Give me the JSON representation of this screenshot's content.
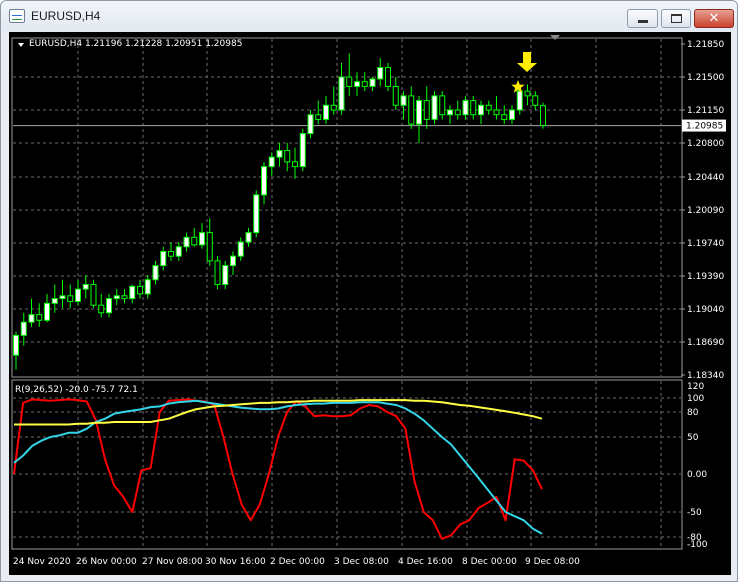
{
  "window": {
    "title": "EURUSD,H4",
    "buttons": {
      "minimize": "minimize",
      "maximize": "maximize",
      "close": "✕"
    }
  },
  "colors": {
    "background": "#000000",
    "grid": "#6b6b6b",
    "bull_candle": "#ffffff",
    "bear_candle": "#000000",
    "candle_outline": "#00ff00",
    "text": "#ffffff",
    "indicator_red": "#ff0000",
    "indicator_cyan": "#33d6e8",
    "indicator_yellow": "#ffff44",
    "marker": "#ffee00"
  },
  "price_panel": {
    "header_label": "EURUSD,H4  1.21196 1.21228 1.20951 1.20985",
    "current_price": "1.20985",
    "y_ticks": [
      "1.21850",
      "1.21500",
      "1.21150",
      "1.20800",
      "1.20440",
      "1.20090",
      "1.19740",
      "1.19390",
      "1.19040",
      "1.18690",
      "1.18340"
    ],
    "annotations": [
      "yellow-star",
      "yellow-down-arrow"
    ]
  },
  "indicator_panel": {
    "header_label": "R(9,26,52) -20.0 -75.7 72.1",
    "y_ticks": [
      "120",
      "100",
      "80",
      "50",
      "0.00",
      "-50",
      "-80",
      "-100"
    ]
  },
  "x_ticks": [
    "24 Nov 2020",
    "26 Nov 00:00",
    "27 Nov 08:00",
    "30 Nov 16:00",
    "2 Dec 00:00",
    "3 Dec 08:00",
    "4 Dec 16:00",
    "8 Dec 00:00",
    "9 Dec 08:00"
  ],
  "chart_data": [
    {
      "type": "candlestick",
      "title": "EURUSD,H4",
      "ylim": [
        1.1834,
        1.2185
      ],
      "current_price": 1.20985,
      "last_bar": {
        "open": 1.21196,
        "high": 1.21228,
        "low": 1.20951,
        "close": 1.20985
      },
      "candles": [
        {
          "o": 1.1855,
          "h": 1.188,
          "l": 1.184,
          "c": 1.1876
        },
        {
          "o": 1.1876,
          "h": 1.19,
          "l": 1.1865,
          "c": 1.189
        },
        {
          "o": 1.189,
          "h": 1.1915,
          "l": 1.1885,
          "c": 1.1898
        },
        {
          "o": 1.1898,
          "h": 1.191,
          "l": 1.1885,
          "c": 1.1892
        },
        {
          "o": 1.1892,
          "h": 1.192,
          "l": 1.189,
          "c": 1.191
        },
        {
          "o": 1.191,
          "h": 1.193,
          "l": 1.19,
          "c": 1.1915
        },
        {
          "o": 1.1915,
          "h": 1.1935,
          "l": 1.1905,
          "c": 1.1918
        },
        {
          "o": 1.1918,
          "h": 1.193,
          "l": 1.1905,
          "c": 1.1912
        },
        {
          "o": 1.1912,
          "h": 1.1935,
          "l": 1.1908,
          "c": 1.1925
        },
        {
          "o": 1.1925,
          "h": 1.194,
          "l": 1.1915,
          "c": 1.193
        },
        {
          "o": 1.193,
          "h": 1.1935,
          "l": 1.1905,
          "c": 1.1908
        },
        {
          "o": 1.1908,
          "h": 1.192,
          "l": 1.1895,
          "c": 1.19
        },
        {
          "o": 1.19,
          "h": 1.192,
          "l": 1.1895,
          "c": 1.1915
        },
        {
          "o": 1.1915,
          "h": 1.1925,
          "l": 1.1908,
          "c": 1.1918
        },
        {
          "o": 1.1918,
          "h": 1.1925,
          "l": 1.191,
          "c": 1.1915
        },
        {
          "o": 1.1915,
          "h": 1.193,
          "l": 1.191,
          "c": 1.1928
        },
        {
          "o": 1.1928,
          "h": 1.1935,
          "l": 1.1915,
          "c": 1.192
        },
        {
          "o": 1.192,
          "h": 1.194,
          "l": 1.1915,
          "c": 1.1935
        },
        {
          "o": 1.1935,
          "h": 1.1955,
          "l": 1.193,
          "c": 1.195
        },
        {
          "o": 1.195,
          "h": 1.197,
          "l": 1.1945,
          "c": 1.1965
        },
        {
          "o": 1.1965,
          "h": 1.1975,
          "l": 1.1955,
          "c": 1.196
        },
        {
          "o": 1.196,
          "h": 1.1975,
          "l": 1.1955,
          "c": 1.197
        },
        {
          "o": 1.197,
          "h": 1.1985,
          "l": 1.1965,
          "c": 1.198
        },
        {
          "o": 1.198,
          "h": 1.199,
          "l": 1.197,
          "c": 1.1972
        },
        {
          "o": 1.1972,
          "h": 1.1995,
          "l": 1.1968,
          "c": 1.1985
        },
        {
          "o": 1.1985,
          "h": 1.2,
          "l": 1.195,
          "c": 1.1955
        },
        {
          "o": 1.1955,
          "h": 1.196,
          "l": 1.1925,
          "c": 1.193
        },
        {
          "o": 1.193,
          "h": 1.1955,
          "l": 1.1925,
          "c": 1.195
        },
        {
          "o": 1.195,
          "h": 1.1965,
          "l": 1.194,
          "c": 1.196
        },
        {
          "o": 1.196,
          "h": 1.198,
          "l": 1.1955,
          "c": 1.1975
        },
        {
          "o": 1.1975,
          "h": 1.199,
          "l": 1.197,
          "c": 1.1985
        },
        {
          "o": 1.1985,
          "h": 1.203,
          "l": 1.198,
          "c": 1.2025
        },
        {
          "o": 1.2025,
          "h": 1.206,
          "l": 1.2015,
          "c": 1.2055
        },
        {
          "o": 1.2055,
          "h": 1.207,
          "l": 1.2045,
          "c": 1.2065
        },
        {
          "o": 1.2065,
          "h": 1.208,
          "l": 1.2055,
          "c": 1.2072
        },
        {
          "o": 1.2072,
          "h": 1.208,
          "l": 1.205,
          "c": 1.206
        },
        {
          "o": 1.206,
          "h": 1.2075,
          "l": 1.2042,
          "c": 1.2055
        },
        {
          "o": 1.2055,
          "h": 1.2095,
          "l": 1.205,
          "c": 1.209
        },
        {
          "o": 1.209,
          "h": 1.2115,
          "l": 1.2085,
          "c": 1.211
        },
        {
          "o": 1.211,
          "h": 1.2125,
          "l": 1.21,
          "c": 1.2105
        },
        {
          "o": 1.2105,
          "h": 1.213,
          "l": 1.21,
          "c": 1.212
        },
        {
          "o": 1.212,
          "h": 1.214,
          "l": 1.211,
          "c": 1.2115
        },
        {
          "o": 1.2115,
          "h": 1.2165,
          "l": 1.211,
          "c": 1.215
        },
        {
          "o": 1.215,
          "h": 1.2175,
          "l": 1.213,
          "c": 1.214
        },
        {
          "o": 1.214,
          "h": 1.2155,
          "l": 1.213,
          "c": 1.2145
        },
        {
          "o": 1.2145,
          "h": 1.2155,
          "l": 1.2135,
          "c": 1.214
        },
        {
          "o": 1.214,
          "h": 1.215,
          "l": 1.2135,
          "c": 1.2148
        },
        {
          "o": 1.2148,
          "h": 1.217,
          "l": 1.214,
          "c": 1.216
        },
        {
          "o": 1.216,
          "h": 1.2165,
          "l": 1.2135,
          "c": 1.214
        },
        {
          "o": 1.214,
          "h": 1.215,
          "l": 1.2115,
          "c": 1.212
        },
        {
          "o": 1.212,
          "h": 1.2135,
          "l": 1.2105,
          "c": 1.213
        },
        {
          "o": 1.213,
          "h": 1.214,
          "l": 1.2095,
          "c": 1.21
        },
        {
          "o": 1.21,
          "h": 1.213,
          "l": 1.208,
          "c": 1.2125
        },
        {
          "o": 1.2125,
          "h": 1.214,
          "l": 1.2095,
          "c": 1.2105
        },
        {
          "o": 1.2105,
          "h": 1.2135,
          "l": 1.21,
          "c": 1.213
        },
        {
          "o": 1.213,
          "h": 1.2135,
          "l": 1.2105,
          "c": 1.211
        },
        {
          "o": 1.211,
          "h": 1.212,
          "l": 1.21,
          "c": 1.2115
        },
        {
          "o": 1.2115,
          "h": 1.2125,
          "l": 1.2105,
          "c": 1.211
        },
        {
          "o": 1.211,
          "h": 1.213,
          "l": 1.2105,
          "c": 1.2125
        },
        {
          "o": 1.2125,
          "h": 1.213,
          "l": 1.2105,
          "c": 1.211
        },
        {
          "o": 1.211,
          "h": 1.2125,
          "l": 1.21,
          "c": 1.212
        },
        {
          "o": 1.212,
          "h": 1.2125,
          "l": 1.211,
          "c": 1.2115
        },
        {
          "o": 1.2115,
          "h": 1.213,
          "l": 1.2105,
          "c": 1.211
        },
        {
          "o": 1.211,
          "h": 1.212,
          "l": 1.21,
          "c": 1.2105
        },
        {
          "o": 1.2105,
          "h": 1.212,
          "l": 1.21,
          "c": 1.2115
        },
        {
          "o": 1.2115,
          "h": 1.214,
          "l": 1.211,
          "c": 1.2135
        },
        {
          "o": 1.2135,
          "h": 1.2142,
          "l": 1.212,
          "c": 1.213
        },
        {
          "o": 1.213,
          "h": 1.2135,
          "l": 1.2115,
          "c": 1.212
        },
        {
          "o": 1.21196,
          "h": 1.21228,
          "l": 1.20951,
          "c": 1.20985
        }
      ]
    },
    {
      "type": "line",
      "title": "R(9,26,52)",
      "ylim": [
        -110,
        125
      ],
      "last_values": [
        -20.0,
        -75.7,
        72.1
      ],
      "series": [
        {
          "color": "#ff0000",
          "values": [
            0,
            93,
            98,
            97,
            96,
            97,
            98,
            97,
            95,
            70,
            20,
            -15,
            -30,
            -50,
            5,
            8,
            80,
            96,
            97,
            98,
            96,
            95,
            90,
            50,
            0,
            -40,
            -60,
            -40,
            0,
            50,
            80,
            95,
            88,
            75,
            76,
            75,
            75,
            76,
            85,
            90,
            88,
            80,
            75,
            60,
            -10,
            -50,
            -60,
            -85,
            -78,
            -65,
            -60,
            -45,
            -38,
            -30,
            -60,
            20,
            18,
            5,
            -20
          ]
        },
        {
          "color": "#33d6e8",
          "values": [
            15,
            25,
            38,
            45,
            50,
            52,
            55,
            55,
            60,
            68,
            72,
            78,
            80,
            82,
            84,
            87,
            88,
            92,
            94,
            95,
            96,
            94,
            92,
            90,
            88,
            86,
            85,
            84,
            84,
            85,
            88,
            90,
            91,
            92,
            92,
            93,
            93,
            93,
            94,
            94,
            94,
            92,
            90,
            85,
            78,
            70,
            60,
            50,
            40,
            25,
            10,
            -5,
            -20,
            -35,
            -50,
            -55,
            -60,
            -70,
            -76
          ]
        },
        {
          "color": "#ffff44",
          "values": [
            65,
            65,
            65,
            65,
            65,
            65,
            65,
            66,
            66,
            67,
            67,
            68,
            68,
            68,
            68,
            68,
            70,
            72,
            76,
            80,
            84,
            86,
            88,
            89,
            90,
            91,
            92,
            93,
            93,
            94,
            94,
            95,
            95,
            96,
            96,
            96,
            96,
            96,
            97,
            97,
            97,
            97,
            97,
            97,
            96,
            96,
            95,
            94,
            92,
            90,
            89,
            87,
            85,
            83,
            81,
            79,
            77,
            75,
            72
          ]
        }
      ]
    }
  ]
}
